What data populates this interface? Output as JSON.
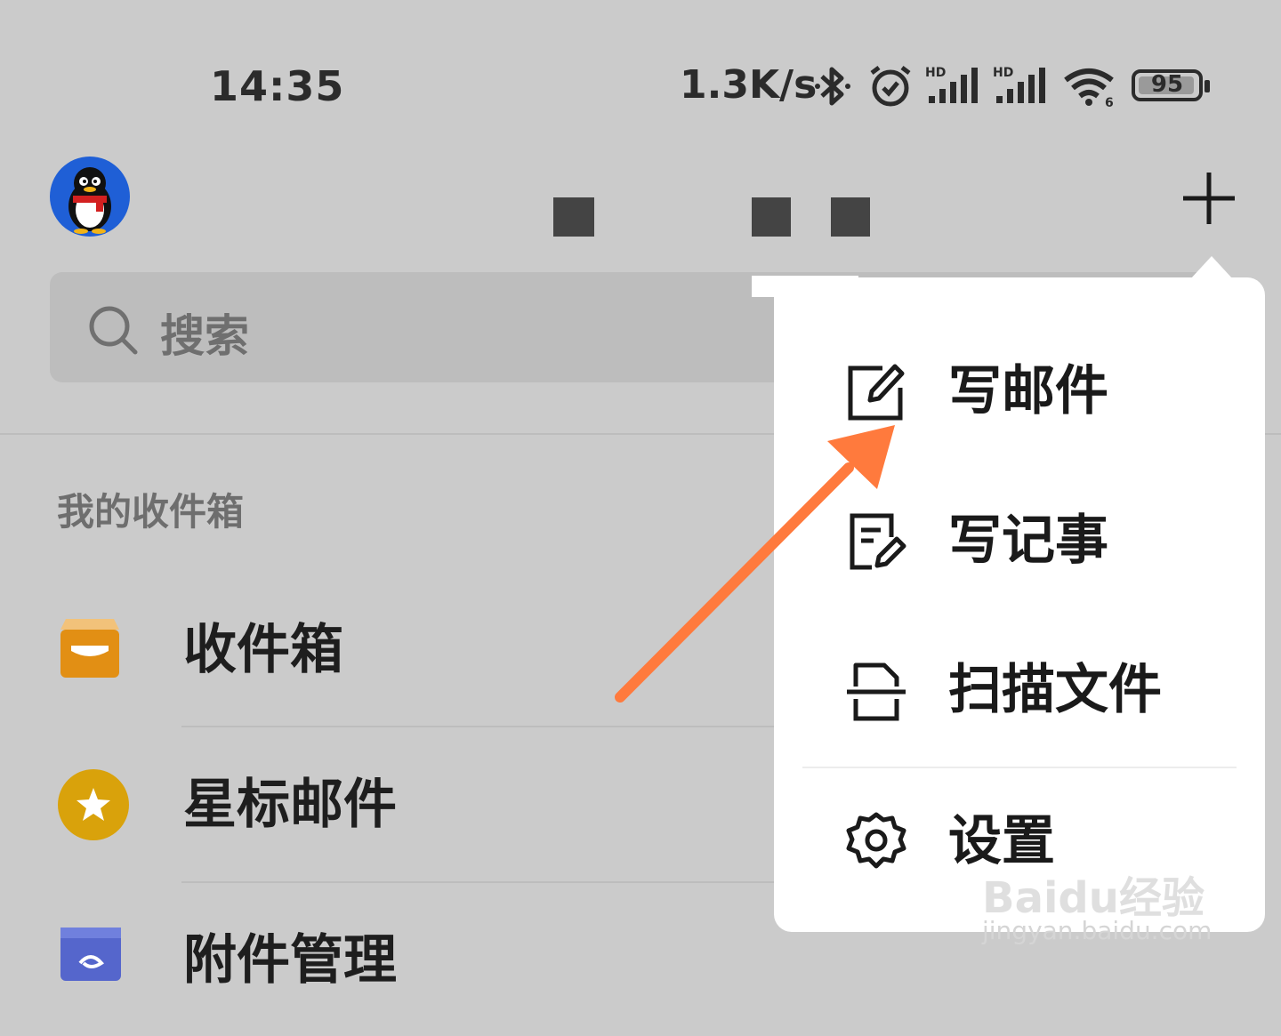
{
  "status_bar": {
    "time": "14:35",
    "network_speed": "1.3K/s",
    "battery_level": "95",
    "icons": [
      "bluetooth-icon",
      "alarm-icon",
      "signal-hd-icon",
      "signal-hd-icon",
      "wifi-icon",
      "battery-icon"
    ]
  },
  "header": {
    "avatar": "qq-penguin-avatar",
    "add_icon": "plus-icon"
  },
  "search": {
    "placeholder": "搜索"
  },
  "mailbox": {
    "section_title": "我的收件箱",
    "items": [
      {
        "label": "收件箱",
        "icon": "inbox-icon",
        "color": "#e28f14"
      },
      {
        "label": "星标邮件",
        "icon": "star-icon",
        "color": "#d9a20b"
      },
      {
        "label": "附件管理",
        "icon": "attachment-icon",
        "color": "#5566cc"
      }
    ]
  },
  "menu": {
    "items": [
      {
        "label": "写邮件",
        "icon": "compose-icon"
      },
      {
        "label": "写记事",
        "icon": "note-icon"
      },
      {
        "label": "扫描文件",
        "icon": "scan-icon"
      },
      {
        "label": "设置",
        "icon": "gear-icon"
      }
    ]
  },
  "annotation": {
    "arrow_color": "#ff7a3d"
  },
  "watermark": {
    "line1": "Baidu经验",
    "line2": "jingyan.baidu.com"
  }
}
